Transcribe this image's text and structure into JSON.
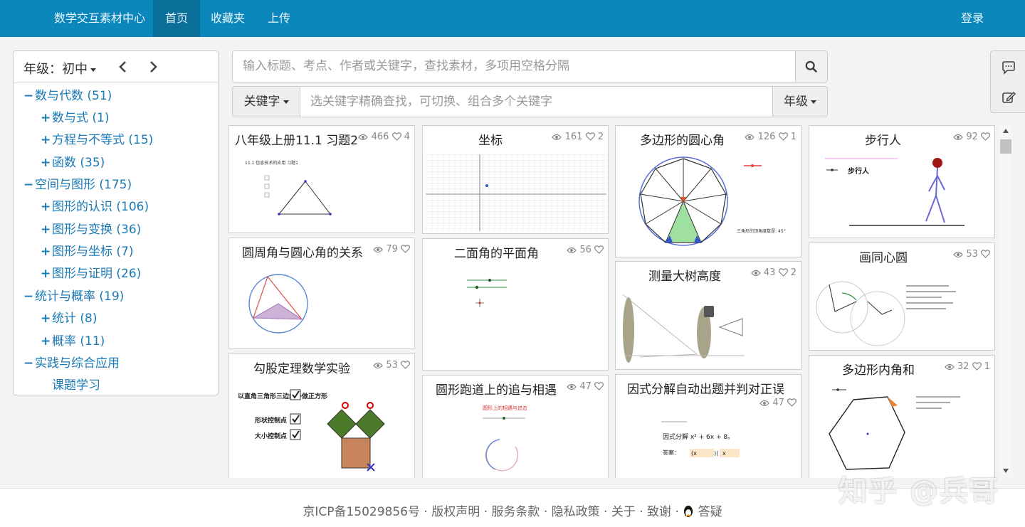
{
  "nav": {
    "brand": "数学交互素材中心",
    "home": "首页",
    "favorites": "收藏夹",
    "upload": "上传",
    "login": "登录"
  },
  "sidebar": {
    "grade_label": "年级：初中",
    "tree": [
      {
        "sym": "−",
        "label": "数与代数 (51)"
      },
      {
        "sym": "+",
        "label": "数与式 (1)"
      },
      {
        "sym": "+",
        "label": "方程与不等式 (15)"
      },
      {
        "sym": "+",
        "label": "函数 (35)"
      },
      {
        "sym": "−",
        "label": "空间与图形 (175)"
      },
      {
        "sym": "+",
        "label": "图形的认识 (106)"
      },
      {
        "sym": "+",
        "label": "图形与变换 (36)"
      },
      {
        "sym": "+",
        "label": "图形与坐标 (7)"
      },
      {
        "sym": "+",
        "label": "图形与证明 (26)"
      },
      {
        "sym": "−",
        "label": "统计与概率 (19)"
      },
      {
        "sym": "+",
        "label": "统计 (8)"
      },
      {
        "sym": "+",
        "label": "概率 (11)"
      },
      {
        "sym": "−",
        "label": "实践与综合应用"
      },
      {
        "sym": "",
        "label": "课题学习"
      }
    ]
  },
  "search": {
    "placeholder": "输入标题、考点、作者或关键字，查找素材，多项用空格分隔",
    "keyword_button": "关键字",
    "keyword_placeholder": "选关键字精确查找，可切换、组合多个关键字",
    "grade_button": "年级"
  },
  "cards": [
    {
      "title": "八年级上册11.1 习题2",
      "views": "466",
      "likes": "4",
      "thumb_text": "11.1 信息技术的应用 习题1"
    },
    {
      "title": "坐标",
      "views": "161",
      "likes": "2"
    },
    {
      "title": "多边形的圆心角",
      "views": "126",
      "likes": "1",
      "thumb_text": "三角形的顶角度数是: 45°"
    },
    {
      "title": "步行人",
      "views": "92",
      "likes": "",
      "thumb_text": "步行人"
    },
    {
      "title": "圆周角与圆心角的关系",
      "views": "79",
      "likes": ""
    },
    {
      "title": "二面角的平面角",
      "views": "56",
      "likes": ""
    },
    {
      "title": "测量大树高度",
      "views": "43",
      "likes": "2"
    },
    {
      "title": "画同心圆",
      "views": "53",
      "likes": ""
    },
    {
      "title": "勾股定理数学实验",
      "views": "53",
      "likes": "",
      "thumb_lines": [
        "以直角三角形三边向外做正方形",
        "形状控制点",
        "大小控制点"
      ]
    },
    {
      "title": "圆形跑道上的追与相遇",
      "views": "47",
      "likes": "",
      "thumb_text": "圆形上的相遇与追击"
    },
    {
      "title": "因式分解自动出题并判对正误",
      "views": "47",
      "likes": "",
      "thumb_lines": [
        "因式分解 x² + 6x + 8。",
        "答案：",
        "(x",
        ")(",
        "x"
      ]
    },
    {
      "title": "多边形内角和",
      "views": "32",
      "likes": "1"
    }
  ],
  "footer": {
    "links": "京ICP备15029856号 · 版权声明 · 服务条款 · 隐私政策 · 关于 · 致谢 · ",
    "qa": "答疑"
  },
  "watermark": "知乎 @兵哥",
  "colors": {
    "nav_bg": "#0b87bb",
    "link": "#1a7ab6"
  }
}
